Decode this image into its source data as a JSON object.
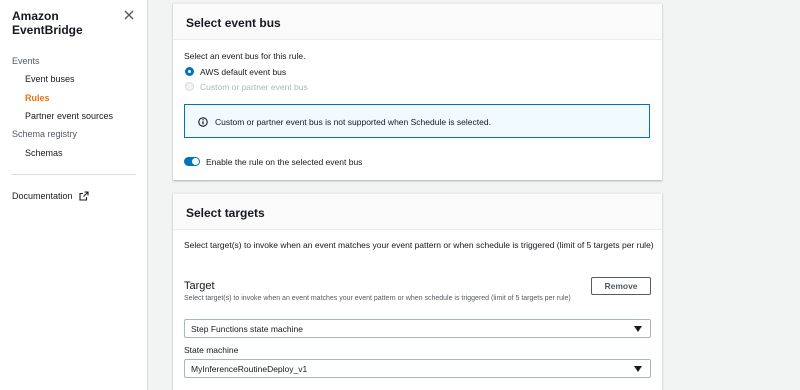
{
  "sidebar": {
    "title_line1": "Amazon",
    "title_line2": "EventBridge",
    "items": [
      {
        "label": "Events"
      },
      {
        "label": "Event buses"
      },
      {
        "label": "Rules"
      },
      {
        "label": "Partner event sources"
      },
      {
        "label": "Schema registry"
      },
      {
        "label": "Schemas"
      }
    ],
    "documentation": "Documentation",
    "active_color": "#ec7211"
  },
  "event_bus": {
    "title": "Select event bus",
    "description": "Select an event bus for this rule.",
    "options": [
      {
        "label": "AWS default event bus",
        "selected": true
      },
      {
        "label": "Custom or partner event bus",
        "disabled": true
      }
    ],
    "info": "Custom or partner event bus is not supported when Schedule is selected.",
    "toggle_label": "Enable the rule on the selected event bus",
    "toggle_on": true
  },
  "targets": {
    "title": "Select targets",
    "description": "Select target(s) to invoke when an event matches your event pattern or when schedule is triggered (limit of 5 targets per rule)",
    "target_heading": "Target",
    "remove_label": "Remove",
    "target_hint": "Select target(s) to invoke when an event matches your event pattern or when schedule is triggered (limit of 5 targets per rule)",
    "target_type_value": "Step Functions state machine",
    "state_machine_label": "State machine",
    "state_machine_value": "MyInferenceRoutineDeploy_v1"
  },
  "colors": {
    "accent": "#0073bb",
    "active_nav": "#ec7211"
  }
}
